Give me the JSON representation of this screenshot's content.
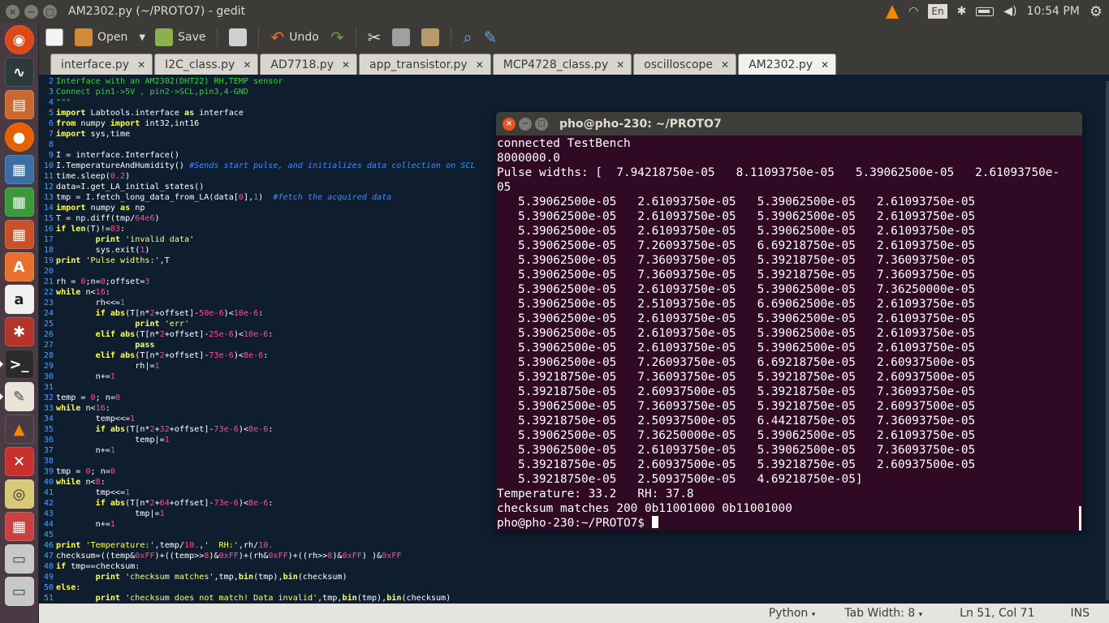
{
  "top_panel": {
    "window_title": "AM2302.py (~/PROTO7) - gedit",
    "keyboard_layout": "En",
    "clock": "10:54 PM"
  },
  "toolbar": {
    "open_label": "Open",
    "save_label": "Save",
    "undo_label": "Undo"
  },
  "tabs": [
    {
      "label": "interface.py"
    },
    {
      "label": "I2C_class.py"
    },
    {
      "label": "AD7718.py"
    },
    {
      "label": "app_transistor.py"
    },
    {
      "label": "MCP4728_class.py"
    },
    {
      "label": "oscilloscope"
    },
    {
      "label": "AM2302.py"
    }
  ],
  "editor": {
    "lines": [
      "2|<span class=\"gr\">Interface with an AM2302(DHT22) RH,TEMP sensor</span>",
      "3|<span class=\"gr\">Connect pin1->5V , pin2->SCL,pin3,4-GND</span>",
      "4|<span class=\"gr\">\"\"\"</span>",
      "5|<span class=\"kw\">import</span> Labtools.interface <span class=\"kw\">as</span> interface",
      "6|<span class=\"kw\">from</span> numpy <span class=\"kw\">import</span> int32,int16",
      "7|<span class=\"kw\">import</span> sys,time",
      "8|",
      "9|I = interface.Interface()",
      "10|I.TemperatureAndHumidity() <span class=\"cm\">#Sends start pulse, and initializes data collection on SCL</span>",
      "11|time.sleep(<span class=\"nu\">0.2</span>)",
      "12|data=I.get_LA_initial_states()",
      "13|tmp = I.fetch_long_data_from_LA(data[<span class=\"nu\">0</span>],<span class=\"nu\">1</span>)  <span class=\"cm\">#fetch the acquired data</span>",
      "14|<span class=\"kw\">import</span> numpy <span class=\"kw\">as</span> np",
      "15|T = np.diff(tmp/<span class=\"nu\">64e6</span>)",
      "16|<span class=\"kw\">if</span> <span class=\"kw\">len</span>(T)!=<span class=\"nu\">83</span>:",
      "17|        <span class=\"kw\">print</span> <span class=\"st\">'invalid data'</span>",
      "18|        sys.exit(<span class=\"nu\">1</span>)",
      "19|<span class=\"kw\">print</span> <span class=\"st\">'Pulse widths:'</span>,T",
      "20|",
      "21|rh = <span class=\"nu\">0</span>;n=<span class=\"nu\">0</span>;offset=<span class=\"nu\">3</span>",
      "22|<span class=\"kw\">while</span> n&lt;<span class=\"nu\">16</span>:",
      "23|        rh&lt;&lt;=<span class=\"nu\">1</span>",
      "24|        <span class=\"kw\">if</span> <span class=\"kw\">abs</span>(T[n*<span class=\"nu\">2</span>+offset]-<span class=\"nu\">50e-6</span>)&lt;<span class=\"nu\">10e-6</span>:",
      "25|                <span class=\"kw\">print</span> <span class=\"st\">'err'</span>",
      "26|        <span class=\"kw\">elif</span> <span class=\"kw\">abs</span>(T[n*<span class=\"nu\">2</span>+offset]-<span class=\"nu\">25e-6</span>)&lt;<span class=\"nu\">10e-6</span>:",
      "27|                <span class=\"kw\">pass</span>",
      "28|        <span class=\"kw\">elif</span> <span class=\"kw\">abs</span>(T[n*<span class=\"nu\">2</span>+offset]-<span class=\"nu\">73e-6</span>)&lt;<span class=\"nu\">8e-6</span>:",
      "29|                rh|=<span class=\"nu\">1</span>",
      "30|        n+=<span class=\"nu\">1</span>",
      "31|",
      "32|temp = <span class=\"nu\">0</span>; n=<span class=\"nu\">0</span>",
      "33|<span class=\"kw\">while</span> n&lt;<span class=\"nu\">16</span>:",
      "34|        temp&lt;&lt;=<span class=\"nu\">1</span>",
      "35|        <span class=\"kw\">if</span> <span class=\"kw\">abs</span>(T[n*<span class=\"nu\">2</span>+<span class=\"nu\">32</span>+offset]-<span class=\"nu\">73e-6</span>)&lt;<span class=\"nu\">8e-6</span>:",
      "36|                temp|=<span class=\"nu\">1</span>",
      "37|        n+=<span class=\"nu\">1</span>",
      "38|",
      "39|tmp = <span class=\"nu\">0</span>; n=<span class=\"nu\">0</span>",
      "40|<span class=\"kw\">while</span> n&lt;<span class=\"nu\">8</span>:",
      "41|        tmp&lt;&lt;=<span class=\"nu\">1</span>",
      "42|        <span class=\"kw\">if</span> <span class=\"kw\">abs</span>(T[n*<span class=\"nu\">2</span>+<span class=\"nu\">64</span>+offset]-<span class=\"nu\">73e-6</span>)&lt;<span class=\"nu\">8e-6</span>:",
      "43|                tmp|=<span class=\"nu\">1</span>",
      "44|        n+=<span class=\"nu\">1</span>",
      "45|",
      "46|<span class=\"kw\">print</span> <span class=\"st\">'Temperature:'</span>,temp/<span class=\"nu\">10.</span>,<span class=\"st\">'  RH:'</span>,rh/<span class=\"nu\">10.</span>",
      "47|checksum=((temp&amp;<span class=\"nu\">0xFF</span>)+((temp&gt;&gt;<span class=\"nu\">8</span>)&amp;<span class=\"nu\">0xFF</span>)+(rh&amp;<span class=\"nu\">0xFF</span>)+((rh&gt;&gt;<span class=\"nu\">8</span>)&amp;<span class=\"nu\">0xFF</span>) )&amp;<span class=\"nu\">0xFF</span>",
      "48|<span class=\"kw\">if</span> tmp==checksum:",
      "49|        <span class=\"kw\">print</span> <span class=\"st\">'checksum matches'</span>,tmp,<span class=\"kw\">bin</span>(tmp),<span class=\"kw\">bin</span>(checksum)",
      "50|<span class=\"kw\">else</span>:",
      "51|        <span class=\"kw\">print</span> <span class=\"st\">'checksum does not match! Data invalid'</span>,tmp,<span class=\"kw\">bin</span>(tmp),<span class=\"kw\">bin</span>(checksum)"
    ]
  },
  "statusbar": {
    "language": "Python",
    "tab_width": "Tab Width: 8",
    "position": "Ln 51, Col 71",
    "mode": "INS"
  },
  "terminal": {
    "title": "pho@pho-230: ~/PROTO7",
    "output": [
      "connected TestBench",
      "8000000.0",
      "Pulse widths: [  7.94218750e-05   8.11093750e-05   5.39062500e-05   2.61093750e-",
      "05",
      "   5.39062500e-05   2.61093750e-05   5.39062500e-05   2.61093750e-05",
      "   5.39062500e-05   2.61093750e-05   5.39062500e-05   2.61093750e-05",
      "   5.39062500e-05   2.61093750e-05   5.39062500e-05   2.61093750e-05",
      "   5.39062500e-05   7.26093750e-05   6.69218750e-05   2.61093750e-05",
      "   5.39062500e-05   7.36093750e-05   5.39218750e-05   7.36093750e-05",
      "   5.39062500e-05   7.36093750e-05   5.39218750e-05   7.36093750e-05",
      "   5.39062500e-05   2.61093750e-05   5.39062500e-05   7.36250000e-05",
      "   5.39062500e-05   2.51093750e-05   6.69062500e-05   2.61093750e-05",
      "   5.39062500e-05   2.61093750e-05   5.39062500e-05   2.61093750e-05",
      "   5.39062500e-05   2.61093750e-05   5.39062500e-05   2.61093750e-05",
      "   5.39062500e-05   2.61093750e-05   5.39062500e-05   2.61093750e-05",
      "   5.39062500e-05   7.26093750e-05   6.69218750e-05   2.60937500e-05",
      "   5.39218750e-05   7.36093750e-05   5.39218750e-05   2.60937500e-05",
      "   5.39218750e-05   2.60937500e-05   5.39218750e-05   7.36093750e-05",
      "   5.39062500e-05   7.36093750e-05   5.39218750e-05   2.60937500e-05",
      "   5.39218750e-05   2.50937500e-05   6.44218750e-05   7.36093750e-05",
      "   5.39062500e-05   7.36250000e-05   5.39062500e-05   2.61093750e-05",
      "   5.39062500e-05   2.61093750e-05   5.39062500e-05   7.36093750e-05",
      "   5.39218750e-05   2.60937500e-05   5.39218750e-05   2.60937500e-05",
      "   5.39218750e-05   2.50937500e-05   4.69218750e-05]",
      "Temperature: 33.2   RH: 37.8",
      "checksum matches 200 0b11001000 0b11001000"
    ],
    "prompt": "pho@pho-230:~/PROTO7$ "
  },
  "launcher": {
    "items": [
      "ubuntu-dash",
      "system-monitor",
      "file-manager",
      "firefox",
      "writer",
      "calc",
      "impress",
      "software-center",
      "amazon",
      "system-settings",
      "terminal",
      "text-editor",
      "vlc",
      "app-x",
      "app-y",
      "workspace-switcher",
      "trash-a",
      "trash-b"
    ]
  }
}
